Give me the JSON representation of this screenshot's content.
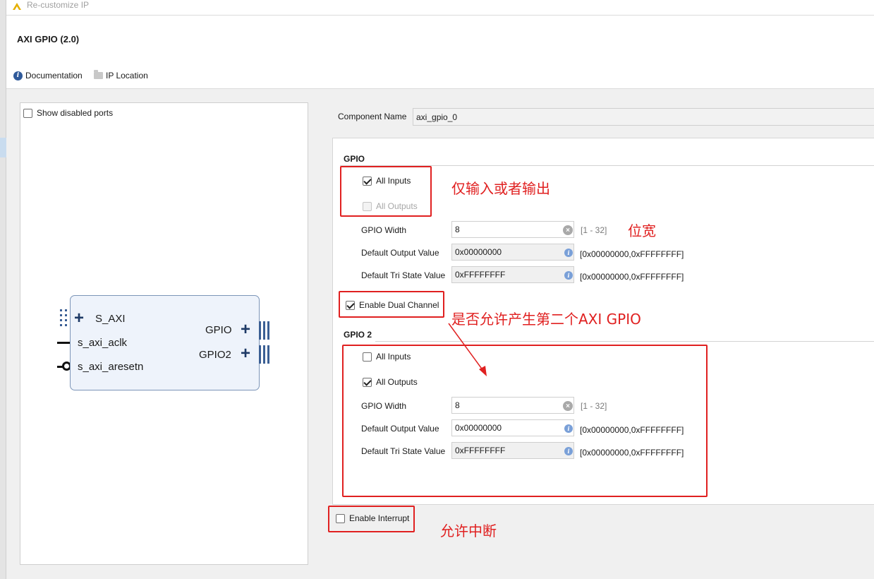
{
  "window": {
    "title": "Re-customize IP"
  },
  "header": {
    "ip_name": "AXI GPIO (2.0)",
    "documentation_label": "Documentation",
    "ip_location_label": "IP Location"
  },
  "preview": {
    "show_disabled_ports_label": "Show disabled ports",
    "show_disabled_ports_checked": false,
    "block": {
      "s_axi": "S_AXI",
      "s_axi_aclk": "s_axi_aclk",
      "s_axi_aresetn": "s_axi_aresetn",
      "gpio": "GPIO",
      "gpio2": "GPIO2"
    }
  },
  "component_name": {
    "label": "Component Name",
    "value": "axi_gpio_0"
  },
  "gpio": {
    "title": "GPIO",
    "all_inputs": {
      "label": "All Inputs",
      "checked": true
    },
    "all_outputs": {
      "label": "All Outputs",
      "checked": false,
      "disabled": true
    },
    "width": {
      "label": "GPIO Width",
      "value": "8",
      "range": "[1 - 32]"
    },
    "default_output": {
      "label": "Default Output Value",
      "value": "0x00000000",
      "range": "[0x00000000,0xFFFFFFFF]"
    },
    "default_tri": {
      "label": "Default Tri State Value",
      "value": "0xFFFFFFFF",
      "range": "[0x00000000,0xFFFFFFFF]"
    }
  },
  "dual_channel": {
    "label": "Enable Dual Channel",
    "checked": true
  },
  "gpio2": {
    "title": "GPIO 2",
    "all_inputs": {
      "label": "All Inputs",
      "checked": false
    },
    "all_outputs": {
      "label": "All Outputs",
      "checked": true
    },
    "width": {
      "label": "GPIO Width",
      "value": "8",
      "range": "[1 - 32]"
    },
    "default_output": {
      "label": "Default Output Value",
      "value": "0x00000000",
      "range": "[0x00000000,0xFFFFFFFF]"
    },
    "default_tri": {
      "label": "Default Tri State Value",
      "value": "0xFFFFFFFF",
      "range": "[0x00000000,0xFFFFFFFF]"
    }
  },
  "interrupt": {
    "label": "Enable Interrupt",
    "checked": false
  },
  "annotations": {
    "io_note": "仅输入或者输出",
    "width_note": "位宽",
    "dual_note": "是否允许产生第二个AXI GPIO",
    "interrupt_note": "允许中断"
  },
  "colors": {
    "annotation": "#e02020",
    "block_fill": "#eef3fb",
    "block_border": "#7c95b8",
    "port_symbol": "#1e3a66"
  }
}
